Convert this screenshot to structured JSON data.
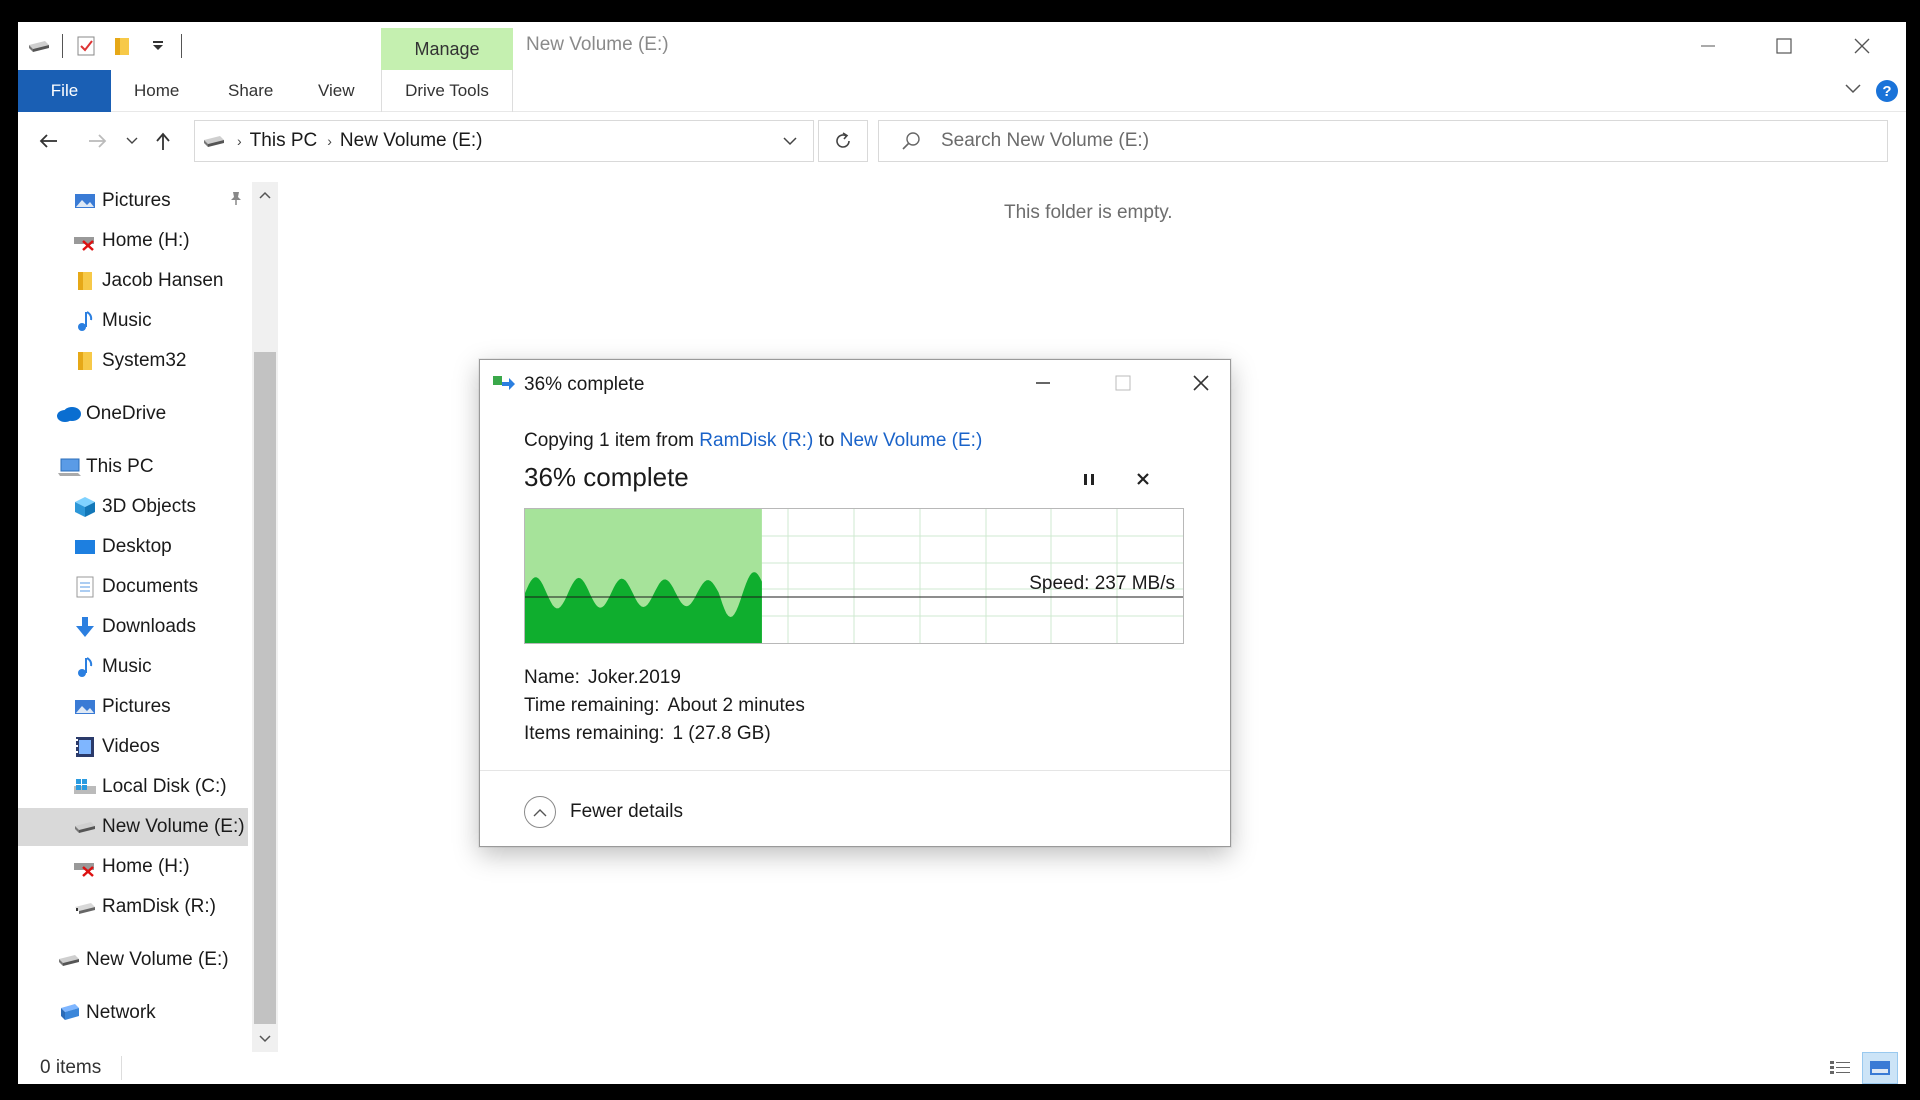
{
  "window": {
    "title": "New Volume (E:)",
    "context_tab": "Manage"
  },
  "ribbon": {
    "tabs": [
      "File",
      "Home",
      "Share",
      "View",
      "Drive Tools"
    ]
  },
  "address": {
    "crumbs": [
      "This PC",
      "New Volume (E:)"
    ],
    "search_placeholder": "Search New Volume (E:)"
  },
  "navpane": {
    "items": [
      {
        "label": "Pictures",
        "icon": "pictures-icon",
        "pinned": true
      },
      {
        "label": "Home (H:)",
        "icon": "disconnected-drive-icon"
      },
      {
        "label": "Jacob Hansen",
        "icon": "folder-icon"
      },
      {
        "label": "Music",
        "icon": "music-icon"
      },
      {
        "label": "System32",
        "icon": "folder-icon"
      },
      {
        "label": "OneDrive",
        "icon": "onedrive-icon"
      },
      {
        "label": "This PC",
        "icon": "this-pc-icon"
      },
      {
        "label": "3D Objects",
        "icon": "3d-objects-icon"
      },
      {
        "label": "Desktop",
        "icon": "desktop-icon"
      },
      {
        "label": "Documents",
        "icon": "documents-icon"
      },
      {
        "label": "Downloads",
        "icon": "downloads-icon"
      },
      {
        "label": "Music",
        "icon": "music-icon"
      },
      {
        "label": "Pictures",
        "icon": "pictures-icon"
      },
      {
        "label": "Videos",
        "icon": "videos-icon"
      },
      {
        "label": "Local Disk (C:)",
        "icon": "windows-drive-icon"
      },
      {
        "label": "New Volume (E:)",
        "icon": "drive-icon",
        "selected": true
      },
      {
        "label": "Home (H:)",
        "icon": "disconnected-drive-icon"
      },
      {
        "label": "RamDisk (R:)",
        "icon": "ramdisk-icon"
      },
      {
        "label": "New Volume (E:)",
        "icon": "drive-icon"
      },
      {
        "label": "Network",
        "icon": "network-icon"
      }
    ]
  },
  "content": {
    "empty_message": "This folder is empty."
  },
  "status": {
    "items_count": "0 items"
  },
  "dialog": {
    "title": "36% complete",
    "copy_prefix": "Copying 1 item from",
    "source": "RamDisk (R:)",
    "to_word": "to",
    "destination": "New Volume (E:)",
    "percent_text": "36% complete",
    "progress": 0.36,
    "speed": "Speed: 237 MB/s",
    "name_label": "Name:",
    "name_value": "Joker.2019",
    "time_label": "Time remaining:",
    "time_value": "About 2 minutes",
    "items_label": "Items remaining:",
    "items_value": "1 (27.8 GB)",
    "fewer_details": "Fewer details"
  },
  "colors": {
    "accent": "#1a5fb4",
    "manage_tab": "#c5f0b0",
    "progress_fill": "#a6e39a",
    "throughput": "#0fae2e",
    "link": "#1a63c9"
  }
}
